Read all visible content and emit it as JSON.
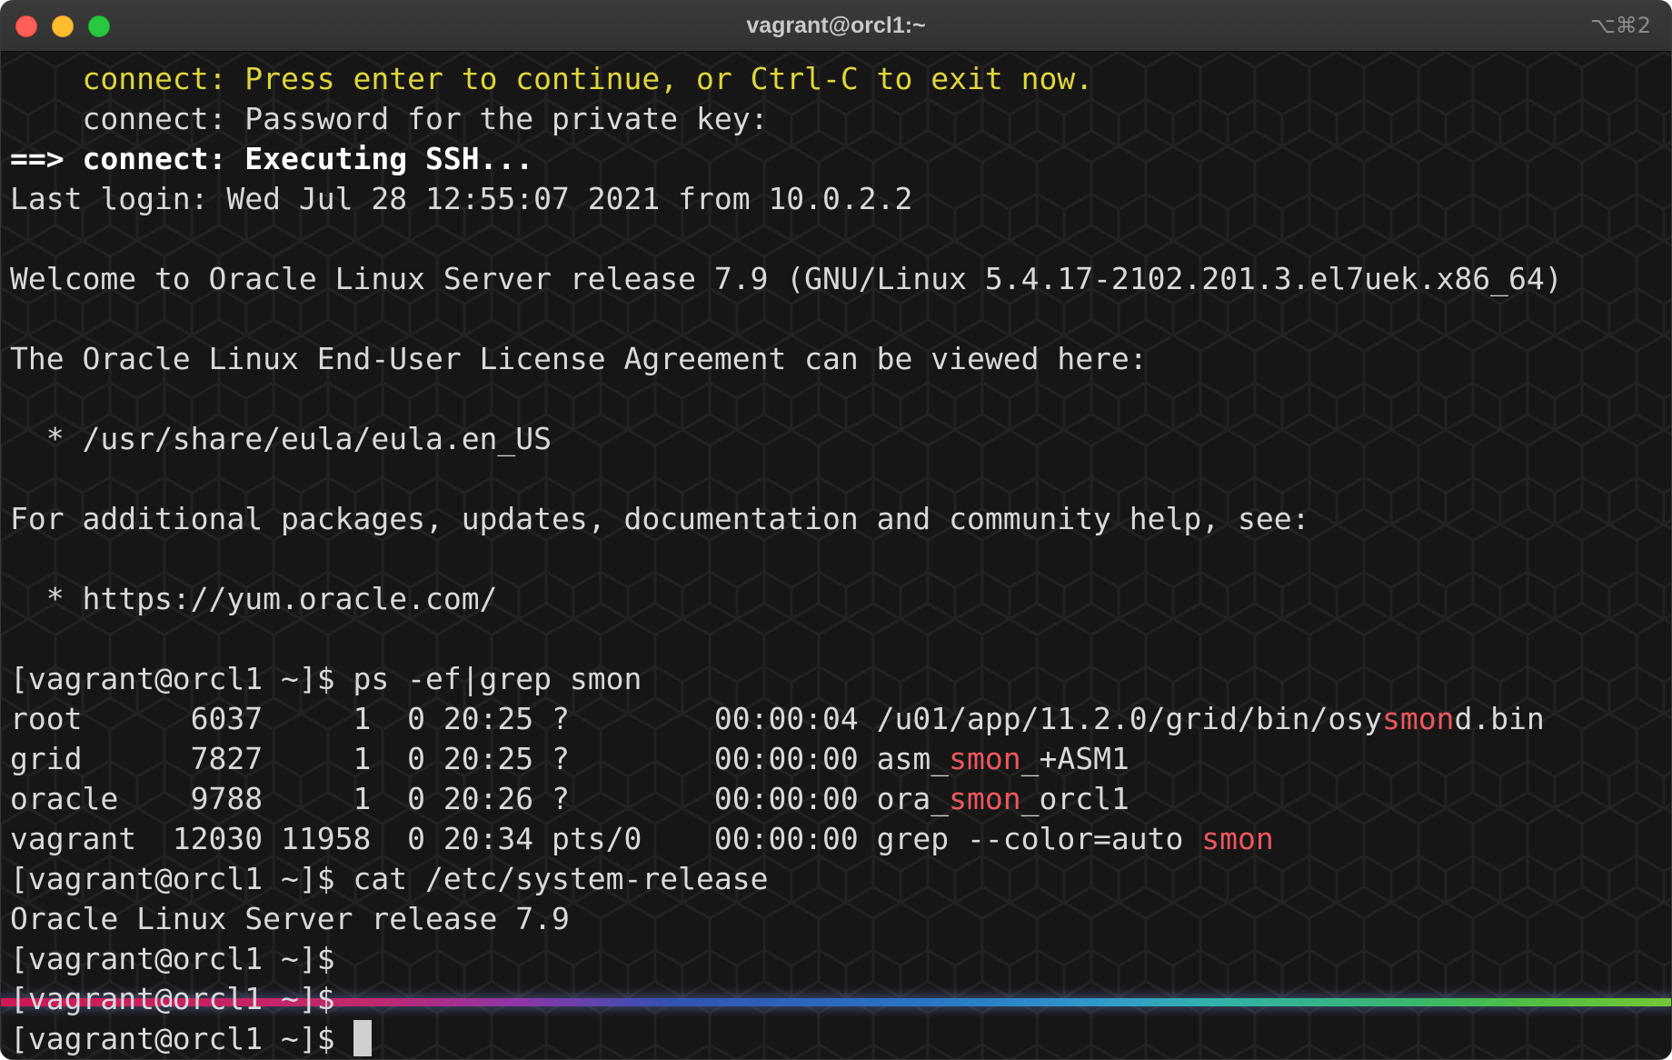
{
  "window": {
    "title": "vagrant@orcl1:~",
    "shortcut": "⌥⌘2"
  },
  "colors": {
    "background": "#161616",
    "text": "#d9d9d9",
    "yellow": "#e0d63a",
    "highlight": "#f0565e"
  },
  "terminal": {
    "lines": [
      [
        {
          "t": "    "
        },
        {
          "t": "connect: Press enter to continue, or Ctrl-C to exit now.",
          "s": "yellow"
        }
      ],
      [
        {
          "t": "    connect: Password for the private key:"
        }
      ],
      [
        {
          "t": "==> connect: Executing SSH...",
          "s": "bold"
        }
      ],
      [
        {
          "t": "Last login: Wed Jul 28 12:55:07 2021 from 10.0.2.2"
        }
      ],
      [
        {
          "t": ""
        }
      ],
      [
        {
          "t": "Welcome to Oracle Linux Server release 7.9 (GNU/Linux 5.4.17-2102.201.3.el7uek.x86_64)"
        }
      ],
      [
        {
          "t": ""
        }
      ],
      [
        {
          "t": "The Oracle Linux End-User License Agreement can be viewed here:"
        }
      ],
      [
        {
          "t": ""
        }
      ],
      [
        {
          "t": "  * /usr/share/eula/eula.en_US"
        }
      ],
      [
        {
          "t": ""
        }
      ],
      [
        {
          "t": "For additional packages, updates, documentation and community help, see:"
        }
      ],
      [
        {
          "t": ""
        }
      ],
      [
        {
          "t": "  * https://yum.oracle.com/"
        }
      ],
      [
        {
          "t": ""
        }
      ],
      [
        {
          "t": "[vagrant@orcl1 ~]$ ps -ef|grep smon"
        }
      ],
      [
        {
          "t": "root      6037     1  0 20:25 ?        00:00:04 /u01/app/11.2.0/grid/bin/osy"
        },
        {
          "t": "smon",
          "s": "hl"
        },
        {
          "t": "d.bin"
        }
      ],
      [
        {
          "t": "grid      7827     1  0 20:25 ?        00:00:00 asm_"
        },
        {
          "t": "smon",
          "s": "hl"
        },
        {
          "t": "_+ASM1"
        }
      ],
      [
        {
          "t": "oracle    9788     1  0 20:26 ?        00:00:00 ora_"
        },
        {
          "t": "smon",
          "s": "hl"
        },
        {
          "t": "_orcl1"
        }
      ],
      [
        {
          "t": "vagrant  12030 11958  0 20:34 pts/0    00:00:00 grep --color=auto "
        },
        {
          "t": "smon",
          "s": "hl"
        }
      ],
      [
        {
          "t": "[vagrant@orcl1 ~]$ cat /etc/system-release"
        }
      ],
      [
        {
          "t": "Oracle Linux Server release 7.9"
        }
      ],
      [
        {
          "t": "[vagrant@orcl1 ~]$"
        }
      ],
      [
        {
          "t": "[vagrant@orcl1 ~]$"
        }
      ],
      [
        {
          "t": "[vagrant@orcl1 ~]$ "
        },
        {
          "cursor": true
        }
      ]
    ]
  }
}
